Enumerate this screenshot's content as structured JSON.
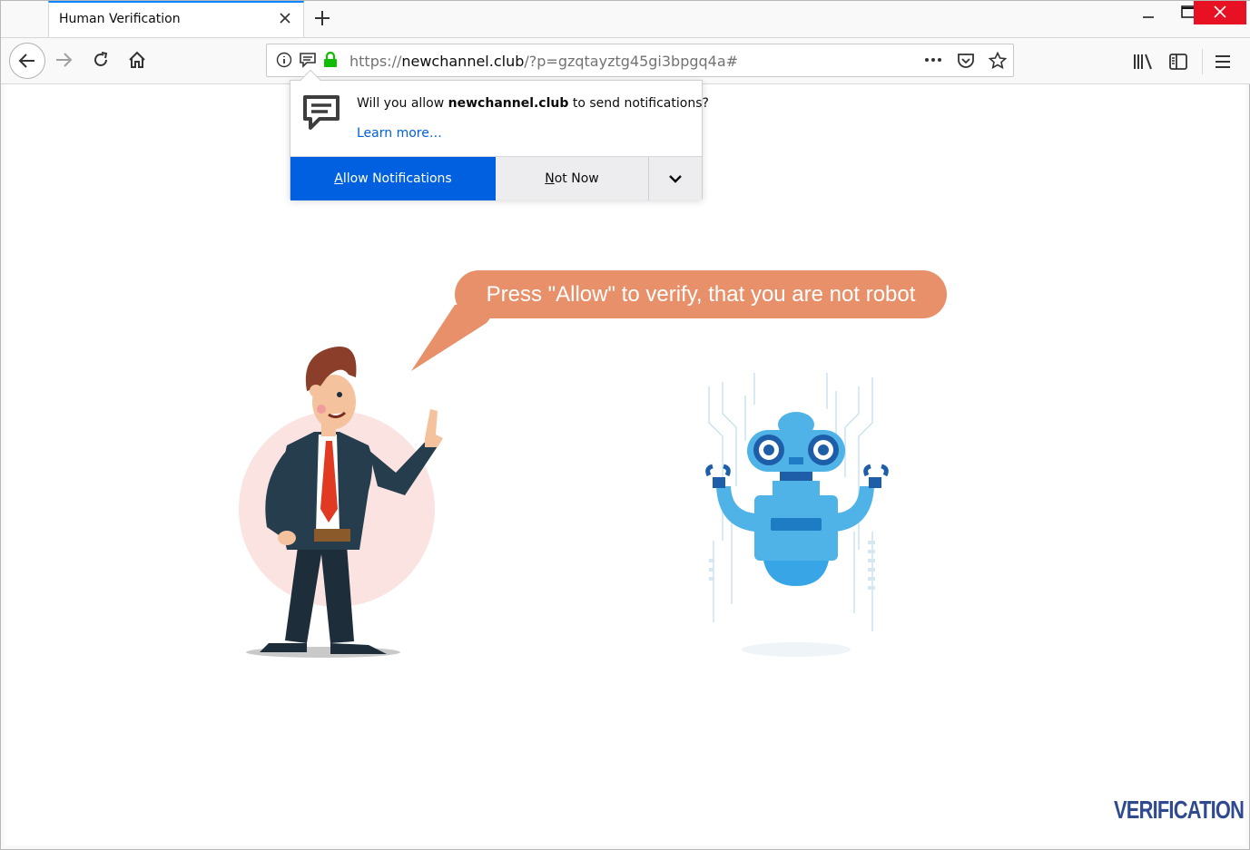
{
  "window": {
    "tab_title": "Human Verification",
    "controls": {
      "minimize": "–",
      "maximize": "□",
      "close": "✕"
    }
  },
  "navbar": {
    "url_scheme": "https://",
    "url_host": "newchannel.club",
    "url_path": "/?p=gzqtayztg45gi3bpgq4a#",
    "page_actions": "•••"
  },
  "doorhanger": {
    "message_prefix": "Will you allow ",
    "message_host": "newchannel.club",
    "message_suffix": " to send notifications?",
    "learn_more": "Learn more…",
    "allow_label": "Allow Notifications",
    "notnow_label": "Not Now"
  },
  "page": {
    "bubble_text": "Press \"Allow\" to verify, that you are not robot",
    "logo_text": "VERIFICATION"
  },
  "colors": {
    "accent_blue": "#0060df",
    "bubble": "#e8906a",
    "logo": "#2f4a8f",
    "secure_lock": "#12bc00"
  }
}
